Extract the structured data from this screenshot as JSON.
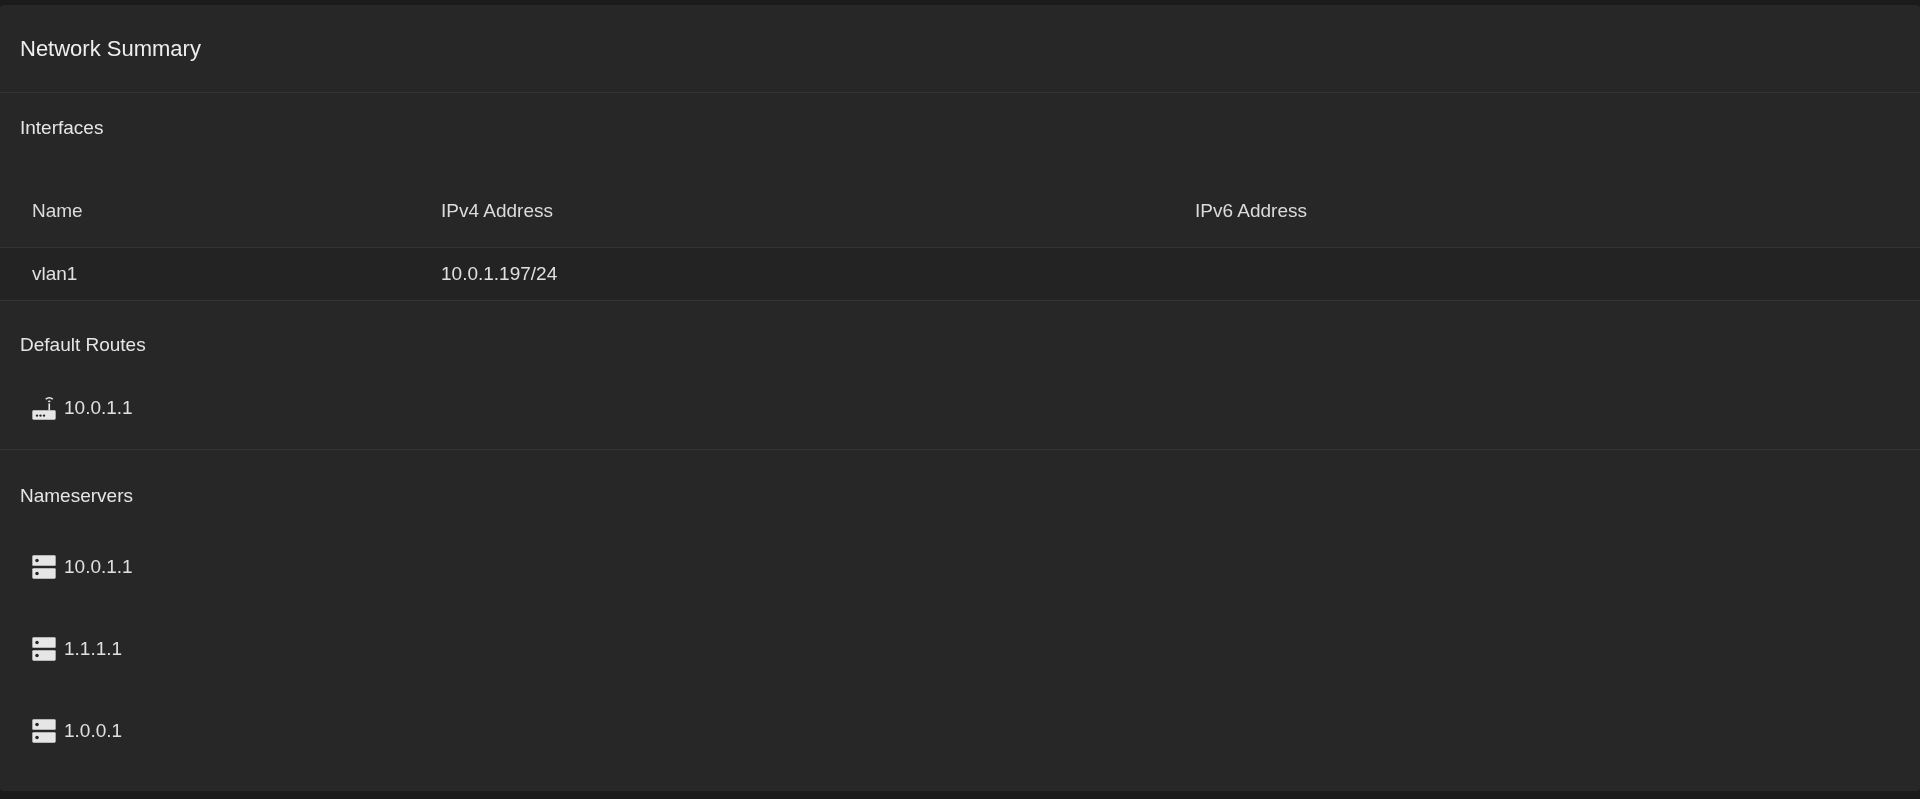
{
  "card": {
    "title": "Network Summary"
  },
  "interfaces": {
    "title": "Interfaces",
    "table": {
      "columns": [
        "Name",
        "IPv4 Address",
        "IPv6 Address"
      ],
      "rows": [
        [
          "vlan1",
          "10.0.1.197/24",
          ""
        ]
      ]
    }
  },
  "default_routes": {
    "title": "Default Routes",
    "items": [
      {
        "kind": "router",
        "address": "10.0.1.1"
      }
    ]
  },
  "nameservers": {
    "title": "Nameservers",
    "items": [
      {
        "kind": "server",
        "address": "10.0.1.1"
      },
      {
        "kind": "server",
        "address": "1.1.1.1"
      },
      {
        "kind": "server",
        "address": "1.0.0.1"
      }
    ]
  }
}
